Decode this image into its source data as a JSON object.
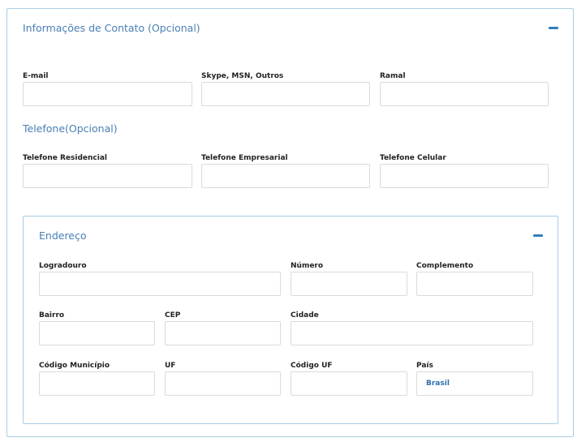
{
  "contact": {
    "title": "Informações de Contato (Opcional)",
    "email_label": "E-mail",
    "email_value": "",
    "skype_label": "Skype, MSN, Outros",
    "skype_value": "",
    "ramal_label": "Ramal",
    "ramal_value": "",
    "phone_section_title": "Telefone(Opcional)",
    "tel_res_label": "Telefone Residencial",
    "tel_res_value": "",
    "tel_emp_label": "Telefone Empresarial",
    "tel_emp_value": "",
    "tel_cel_label": "Telefone Celular",
    "tel_cel_value": ""
  },
  "address": {
    "title": "Endereço",
    "logradouro_label": "Logradouro",
    "logradouro_value": "",
    "numero_label": "Número",
    "numero_value": "",
    "complemento_label": "Complemento",
    "complemento_value": "",
    "bairro_label": "Bairro",
    "bairro_value": "",
    "cep_label": "CEP",
    "cep_value": "",
    "cidade_label": "Cidade",
    "cidade_value": "",
    "cod_municipio_label": "Código Município",
    "cod_municipio_value": "",
    "uf_label": "UF",
    "uf_value": "",
    "cod_uf_label": "Código UF",
    "cod_uf_value": "",
    "pais_label": "País",
    "pais_value": "Brasil"
  },
  "icons": {
    "collapse": "minus-icon"
  },
  "colors": {
    "accent": "#2f7fc0",
    "section_title": "#4a7fb5",
    "panel_border": "#a9cde6",
    "input_border": "#d6dbe0"
  }
}
